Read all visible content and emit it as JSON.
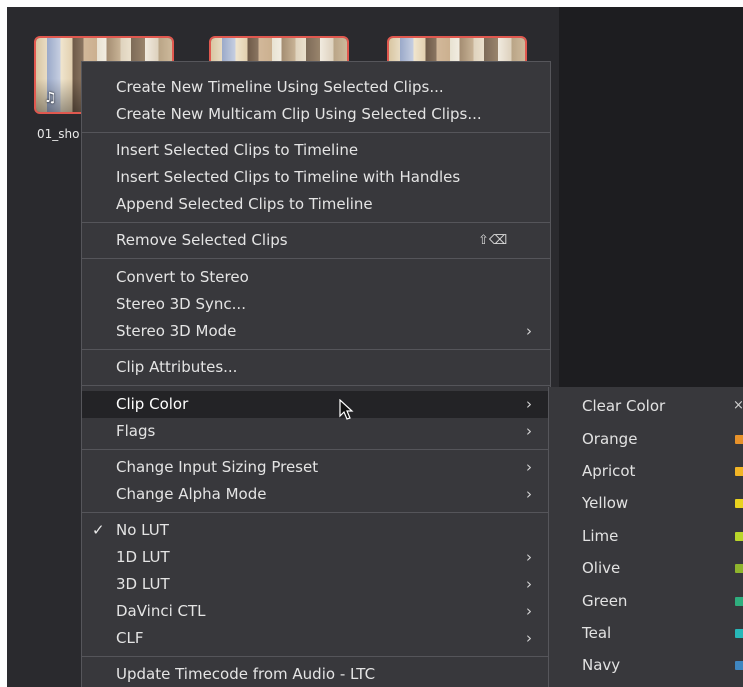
{
  "clips": [
    {
      "label": "01_sho"
    },
    {
      "label": ""
    },
    {
      "label": ""
    }
  ],
  "context_menu": {
    "groups": [
      {
        "items": [
          {
            "label": "Create New Timeline Using Selected Clips..."
          },
          {
            "label": "Create New Multicam Clip Using Selected Clips..."
          }
        ]
      },
      {
        "items": [
          {
            "label": "Insert Selected Clips to Timeline"
          },
          {
            "label": "Insert Selected Clips to Timeline with Handles"
          },
          {
            "label": "Append Selected Clips to Timeline"
          }
        ]
      },
      {
        "items": [
          {
            "label": "Remove Selected Clips",
            "shortcut": "⇧⌫"
          }
        ]
      },
      {
        "items": [
          {
            "label": "Convert to Stereo"
          },
          {
            "label": "Stereo 3D Sync..."
          },
          {
            "label": "Stereo 3D Mode",
            "submenu": true
          }
        ]
      },
      {
        "items": [
          {
            "label": "Clip Attributes..."
          }
        ]
      },
      {
        "items": [
          {
            "label": "Clip Color",
            "submenu": true,
            "highlighted": true
          },
          {
            "label": "Flags",
            "submenu": true
          }
        ]
      },
      {
        "items": [
          {
            "label": "Change Input Sizing Preset",
            "submenu": true
          },
          {
            "label": "Change Alpha Mode",
            "submenu": true
          }
        ]
      },
      {
        "items": [
          {
            "label": "No LUT",
            "checked": true
          },
          {
            "label": "1D LUT",
            "submenu": true
          },
          {
            "label": "3D LUT",
            "submenu": true
          },
          {
            "label": "DaVinci CTL",
            "submenu": true
          },
          {
            "label": "CLF",
            "submenu": true
          }
        ]
      },
      {
        "items": [
          {
            "label": "Update Timecode from Audio - LTC"
          }
        ]
      }
    ]
  },
  "clip_color_submenu": {
    "items": [
      {
        "label": "Clear Color",
        "clear": true
      },
      {
        "label": "Orange",
        "color": "#e8922a"
      },
      {
        "label": "Apricot",
        "color": "#f2b526"
      },
      {
        "label": "Yellow",
        "color": "#e9d21f"
      },
      {
        "label": "Lime",
        "color": "#b9d62a"
      },
      {
        "label": "Olive",
        "color": "#8fb52d"
      },
      {
        "label": "Green",
        "color": "#2fae7e"
      },
      {
        "label": "Teal",
        "color": "#27b7b8"
      },
      {
        "label": "Navy",
        "color": "#3f86c0"
      }
    ]
  },
  "symbols": {
    "chevron": "›",
    "check": "✓",
    "music": "♫",
    "close": "×"
  },
  "theme": {
    "clip_border": "#e0584f",
    "menu_bg": "#38383c",
    "highlight_bg": "#232326"
  }
}
